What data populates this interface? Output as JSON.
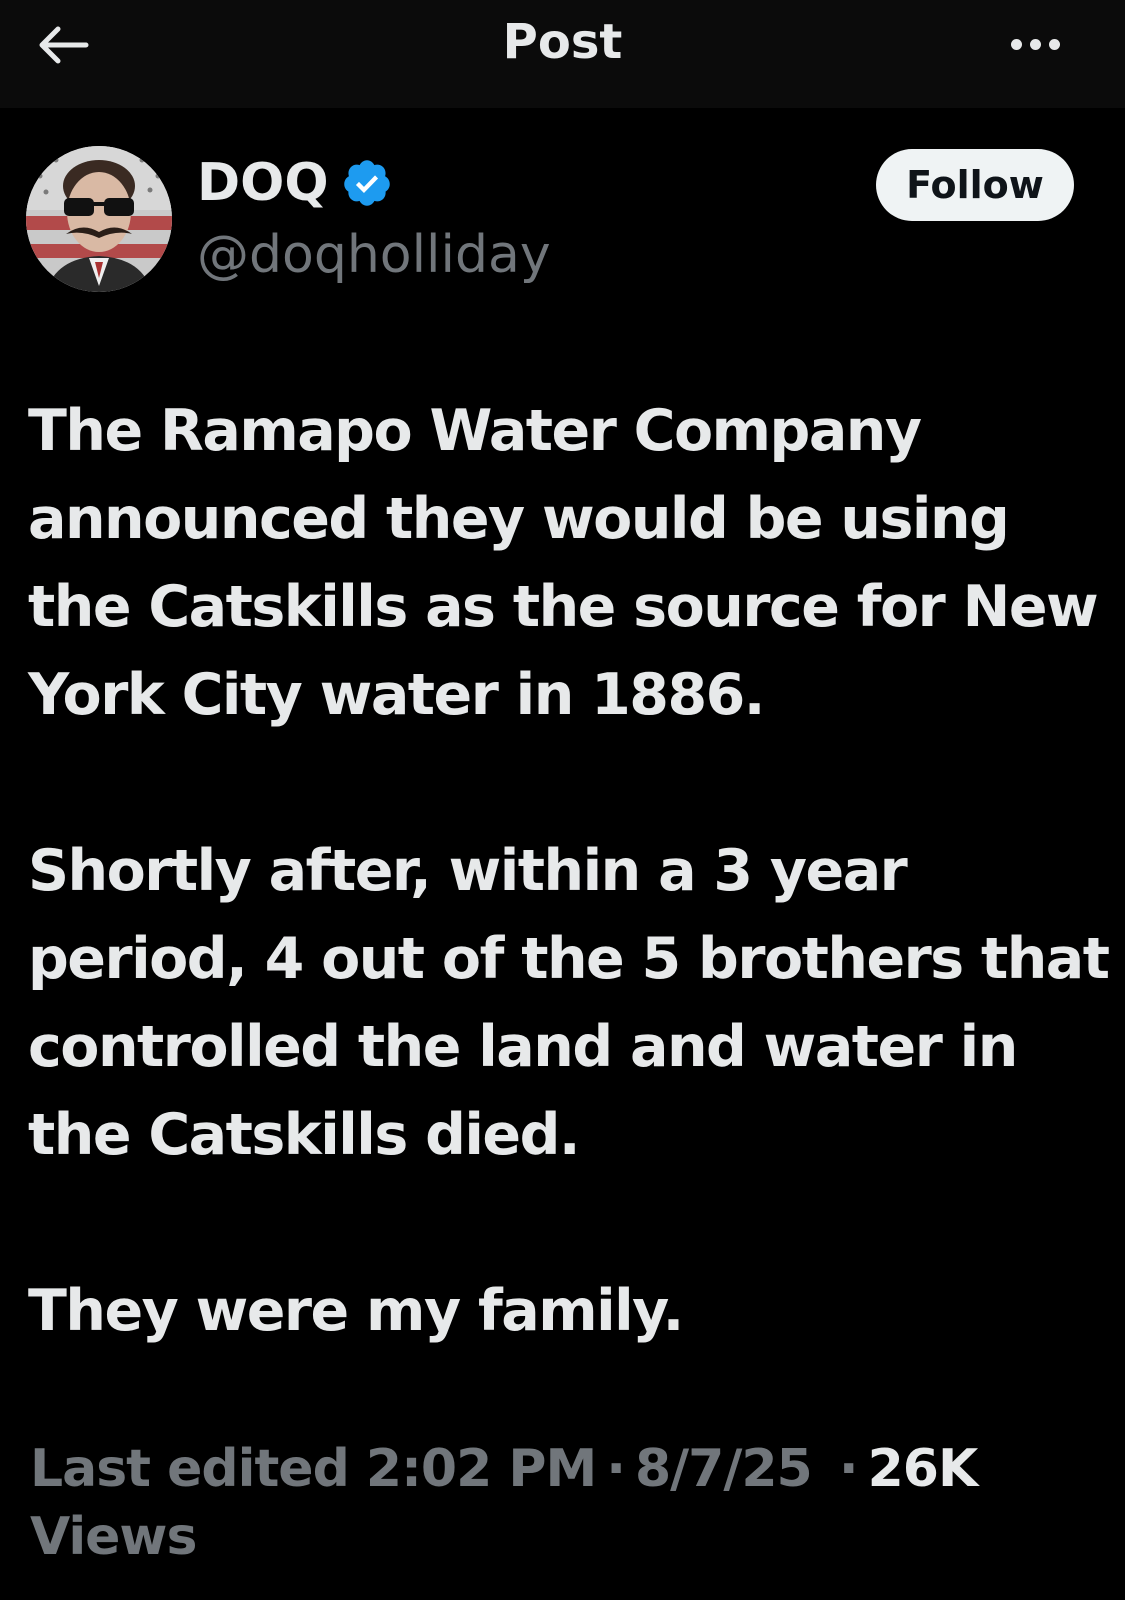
{
  "header": {
    "title": "Post",
    "back_icon": "arrow-left-icon",
    "more_icon": "ellipsis-icon"
  },
  "author": {
    "name": "DOQ",
    "handle": "@doqholliday",
    "verified_icon": "verified-badge-icon",
    "verified_color": "#1d9bf0",
    "follow_label": "Follow"
  },
  "post": {
    "paragraphs": [
      "The Ramapo Water Company announced they would be using the Catskills as the source for New York City water in 1886.",
      "Shortly after, within a 3 year period, 4 out of the 5 brothers that controlled the land and water in the Catskills died.",
      "They were my family."
    ]
  },
  "meta": {
    "edited_label": "Last edited",
    "time": "2:02 PM",
    "separator": "·",
    "date": "8/7/25",
    "views_count": "26K",
    "views_label": "Views"
  },
  "colors": {
    "background": "#000000",
    "header_bg": "#0b0b0b",
    "text": "#e7e9ea",
    "secondary": "#71767b",
    "follow_bg": "#eff3f4"
  }
}
